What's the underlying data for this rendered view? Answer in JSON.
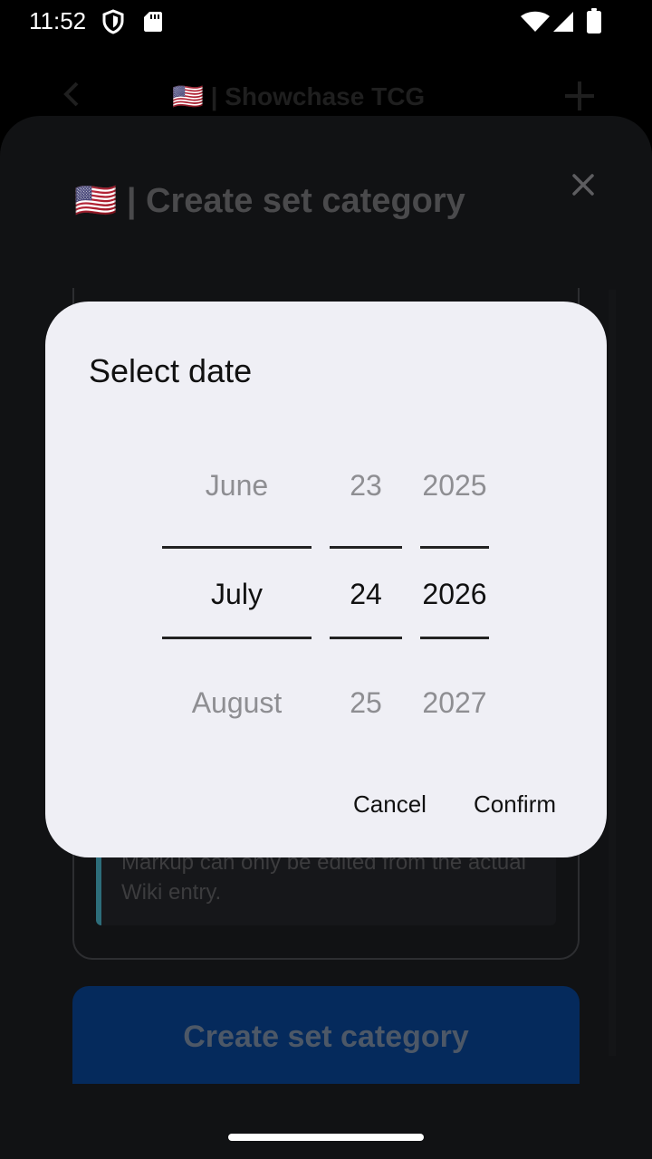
{
  "status_bar": {
    "time": "11:52"
  },
  "app_bar": {
    "title": "🇺🇸 | Showchase TCG"
  },
  "sheet": {
    "title": "🇺🇸 | Create set category",
    "info_text": "Markup can only be edited from the actual Wiki entry.",
    "create_button": "Create set category"
  },
  "dialog": {
    "title": "Select date",
    "month": {
      "prev": "June",
      "selected": "July",
      "next": "August"
    },
    "day": {
      "prev": "23",
      "selected": "24",
      "next": "25"
    },
    "year": {
      "prev": "2025",
      "selected": "2026",
      "next": "2027"
    },
    "cancel_label": "Cancel",
    "confirm_label": "Confirm"
  },
  "colors": {
    "dialog_bg": "#efeff5",
    "sheet_bg": "#111214",
    "create_button_bg": "#052a5c",
    "info_accent": "#2d6d7a"
  }
}
